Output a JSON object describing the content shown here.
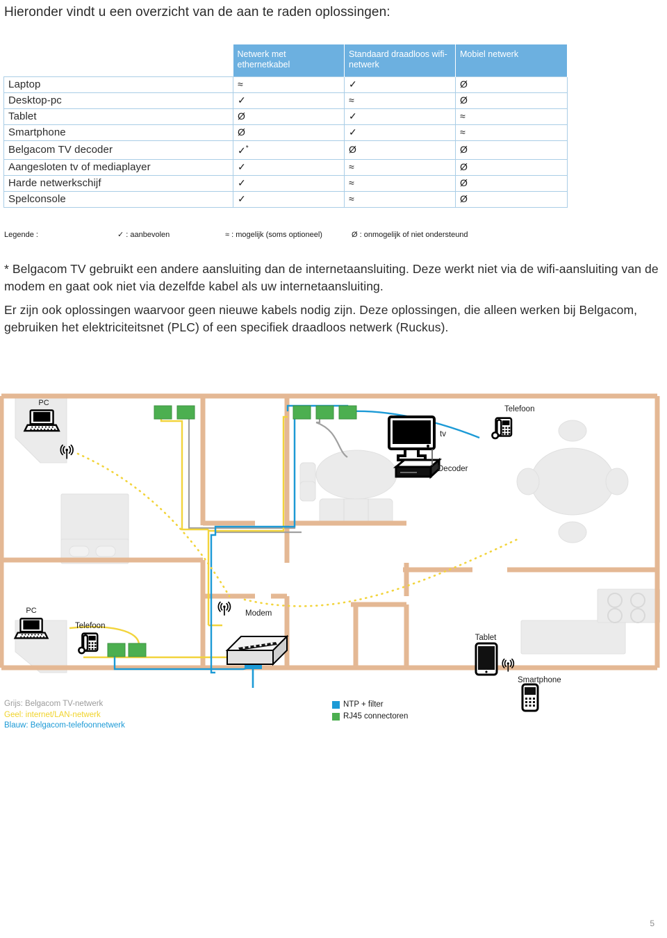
{
  "intro": {
    "heading": "Hieronder vindt u een overzicht van de aan te raden oplossingen:"
  },
  "table": {
    "columns": [
      {
        "label": ""
      },
      {
        "label": "Netwerk met ethernetkabel"
      },
      {
        "label": "Standaard draadloos wifi-netwerk"
      },
      {
        "label": "Mobiel netwerk"
      }
    ],
    "rows": [
      {
        "device": "Laptop",
        "ethernet": "≈",
        "wifi": "✓",
        "mobile": "Ø"
      },
      {
        "device": "Desktop-pc",
        "ethernet": "✓",
        "wifi": "≈",
        "mobile": "Ø"
      },
      {
        "device": "Tablet",
        "ethernet": "Ø",
        "wifi": "✓",
        "mobile": "≈"
      },
      {
        "device": "Smartphone",
        "ethernet": "Ø",
        "wifi": "✓",
        "mobile": "≈"
      },
      {
        "device": "Belgacom TV decoder",
        "ethernet": "✓",
        "wifi": "Ø",
        "mobile": "Ø",
        "ethernet_star": true
      },
      {
        "device": "Aangesloten tv of mediaplayer",
        "ethernet": "✓",
        "wifi": "≈",
        "mobile": "Ø"
      },
      {
        "device": "Harde netwerkschijf",
        "ethernet": "✓",
        "wifi": "≈",
        "mobile": "Ø"
      },
      {
        "device": "Spelconsole",
        "ethernet": "✓",
        "wifi": "≈",
        "mobile": "Ø"
      }
    ],
    "header_bg": "#6cb0e0",
    "border_color": "#a9cde6"
  },
  "legend": {
    "title": "Legende :",
    "item1": "✓ : aanbevolen",
    "item2": "≈ : mogelijk (soms optioneel)",
    "item3": "Ø : onmogelijk of niet ondersteund"
  },
  "paragraphs": {
    "footnote": "* Belgacom TV gebruikt een andere aansluiting dan de internetaansluiting. Deze werkt niet via de wifi-aansluiting van de modem en gaat ook niet via dezelfde kabel als uw internetaansluiting.",
    "plc": "Er zijn ook oplossingen waarvoor geen nieuwe kabels nodig zijn. Deze oplossingen, die alleen werken bij Belgacom, gebruiken het elektriciteitsnet (PLC) of een specifiek draadloos netwerk (Ruckus)."
  },
  "floorplan": {
    "labels": {
      "pc_top": "PC",
      "pc_bottom": "PC",
      "tv": "tv",
      "decoder": "Decoder",
      "telefoon_top": "Telefoon",
      "telefoon_bottom": "Telefoon",
      "tablet": "Tablet",
      "smartphone": "Smartphone",
      "modem": "Modem"
    },
    "colors": {
      "wall": "#e4b894",
      "window": "#bfe0f2",
      "furniture": "#e8e8e8",
      "tv_cable": "#a0a0a0",
      "lan_cable": "#f2d43c",
      "phone_cable": "#1c9ad6",
      "rj45": "#4caf50",
      "ntp": "#1c9ad6"
    }
  },
  "cable_legend": {
    "grey": "Grijs: Belgacom TV-netwerk",
    "yellow": "Geel: internet/LAN-netwerk",
    "blue": "Blauw: Belgacom-telefoonnetwerk"
  },
  "connector_legend": {
    "ntp": "NTP + filter",
    "rj45": "RJ45 connectoren",
    "ntp_color": "#1c9ad6",
    "rj45_color": "#4caf50"
  },
  "page_number": "5"
}
